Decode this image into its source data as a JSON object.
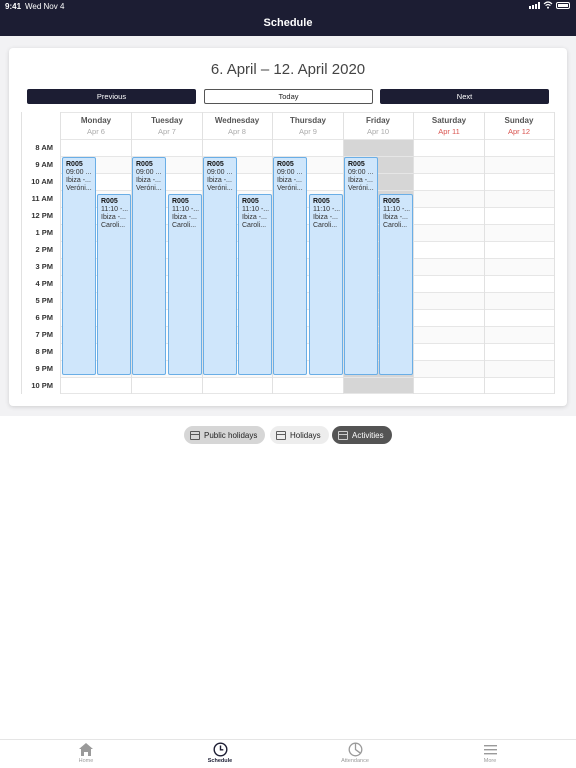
{
  "status_bar": {
    "time": "9:41",
    "date": "Wed Nov 4"
  },
  "header": {
    "title": "Schedule"
  },
  "schedule": {
    "range_title": "6. April – 12. April 2020",
    "buttons": {
      "previous": "Previous",
      "today": "Today",
      "next": "Next"
    },
    "time_labels": [
      "8 AM",
      "9 AM",
      "10 AM",
      "11 AM",
      "12 PM",
      "1 PM",
      "2 PM",
      "3 PM",
      "4 PM",
      "5 PM",
      "6 PM",
      "7 PM",
      "8 PM",
      "9 PM",
      "10 PM"
    ],
    "days": [
      {
        "name": "Monday",
        "date": "Apr 6"
      },
      {
        "name": "Tuesday",
        "date": "Apr 7"
      },
      {
        "name": "Wednesday",
        "date": "Apr 8"
      },
      {
        "name": "Thursday",
        "date": "Apr 9"
      },
      {
        "name": "Friday",
        "date": "Apr 10"
      },
      {
        "name": "Saturday",
        "date": "Apr 11"
      },
      {
        "name": "Sunday",
        "date": "Apr 12"
      }
    ],
    "event_morning": {
      "code": "R005",
      "time": "09:00 ...",
      "place": "Ibiza -...",
      "person": "Veróni..."
    },
    "event_late": {
      "code": "R005",
      "time": "11:10 -...",
      "place": "Ibiza -...",
      "person": "Caroli..."
    }
  },
  "filters": {
    "public_holidays": "Public holidays",
    "holidays": "Holidays",
    "activities": "Activities"
  },
  "tabbar": {
    "home": "Home",
    "schedule": "Schedule",
    "attendance": "Attendance",
    "more": "More"
  },
  "colors": {
    "navy": "#1c1d33",
    "event_fill": "#cfe6fb",
    "event_border": "#6aaee6",
    "weekend_date": "#d9534f"
  }
}
